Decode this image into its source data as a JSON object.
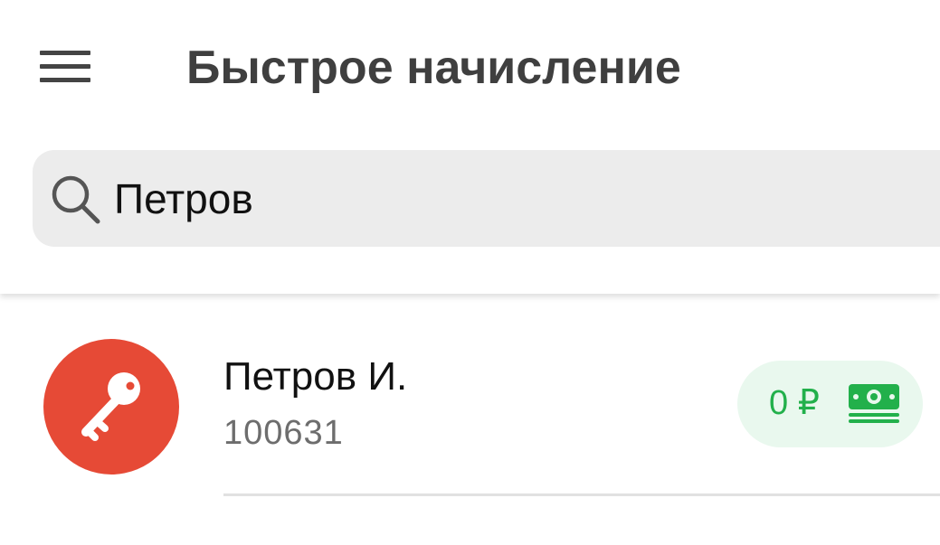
{
  "header": {
    "title": "Быстрое начисление",
    "menu_icon": "hamburger-menu-icon"
  },
  "search": {
    "icon": "search-icon",
    "value": "Петров"
  },
  "results": [
    {
      "name": "Петров И.",
      "account_id": "100631",
      "avatar_icon": "key-icon",
      "avatar_color": "#e64a36",
      "balance": "0 ₽",
      "balance_color": "#22b04b",
      "balance_icon": "money-icon"
    }
  ]
}
